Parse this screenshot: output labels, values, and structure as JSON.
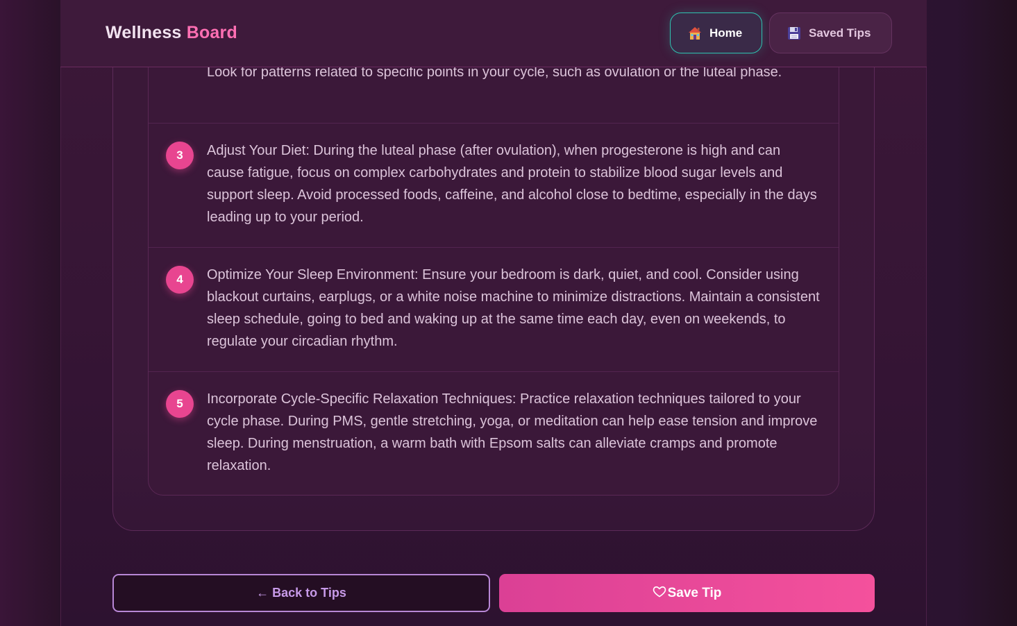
{
  "header": {
    "brand_part1": "Wellness",
    "brand_part2": "Board",
    "nav": {
      "home": "Home",
      "saved": "Saved Tips"
    }
  },
  "steps": [
    {
      "number": "",
      "text": "Look for patterns related to specific points in your cycle, such as ovulation or the luteal phase."
    },
    {
      "number": "3",
      "text": "Adjust Your Diet: During the luteal phase (after ovulation), when progesterone is high and can cause fatigue, focus on complex carbohydrates and protein to stabilize blood sugar levels and support sleep. Avoid processed foods, caffeine, and alcohol close to bedtime, especially in the days leading up to your period."
    },
    {
      "number": "4",
      "text": "Optimize Your Sleep Environment: Ensure your bedroom is dark, quiet, and cool. Consider using blackout curtains, earplugs, or a white noise machine to minimize distractions. Maintain a consistent sleep schedule, going to bed and waking up at the same time each day, even on weekends, to regulate your circadian rhythm."
    },
    {
      "number": "5",
      "text": "Incorporate Cycle-Specific Relaxation Techniques: Practice relaxation techniques tailored to your cycle phase. During PMS, gentle stretching, yoga, or meditation can help ease tension and improve sleep. During menstruation, a warm bath with Epsom salts can alleviate cramps and promote relaxation."
    }
  ],
  "actions": {
    "back": "← Back to Tips",
    "save": "Save Tip"
  },
  "icons": {
    "home": "house-icon",
    "saved": "floppy-disk-icon",
    "save": "heart-icon"
  },
  "colors": {
    "accent_pink": "#e84590",
    "accent_teal": "#2fc3b1",
    "accent_purple": "#b887d6"
  }
}
